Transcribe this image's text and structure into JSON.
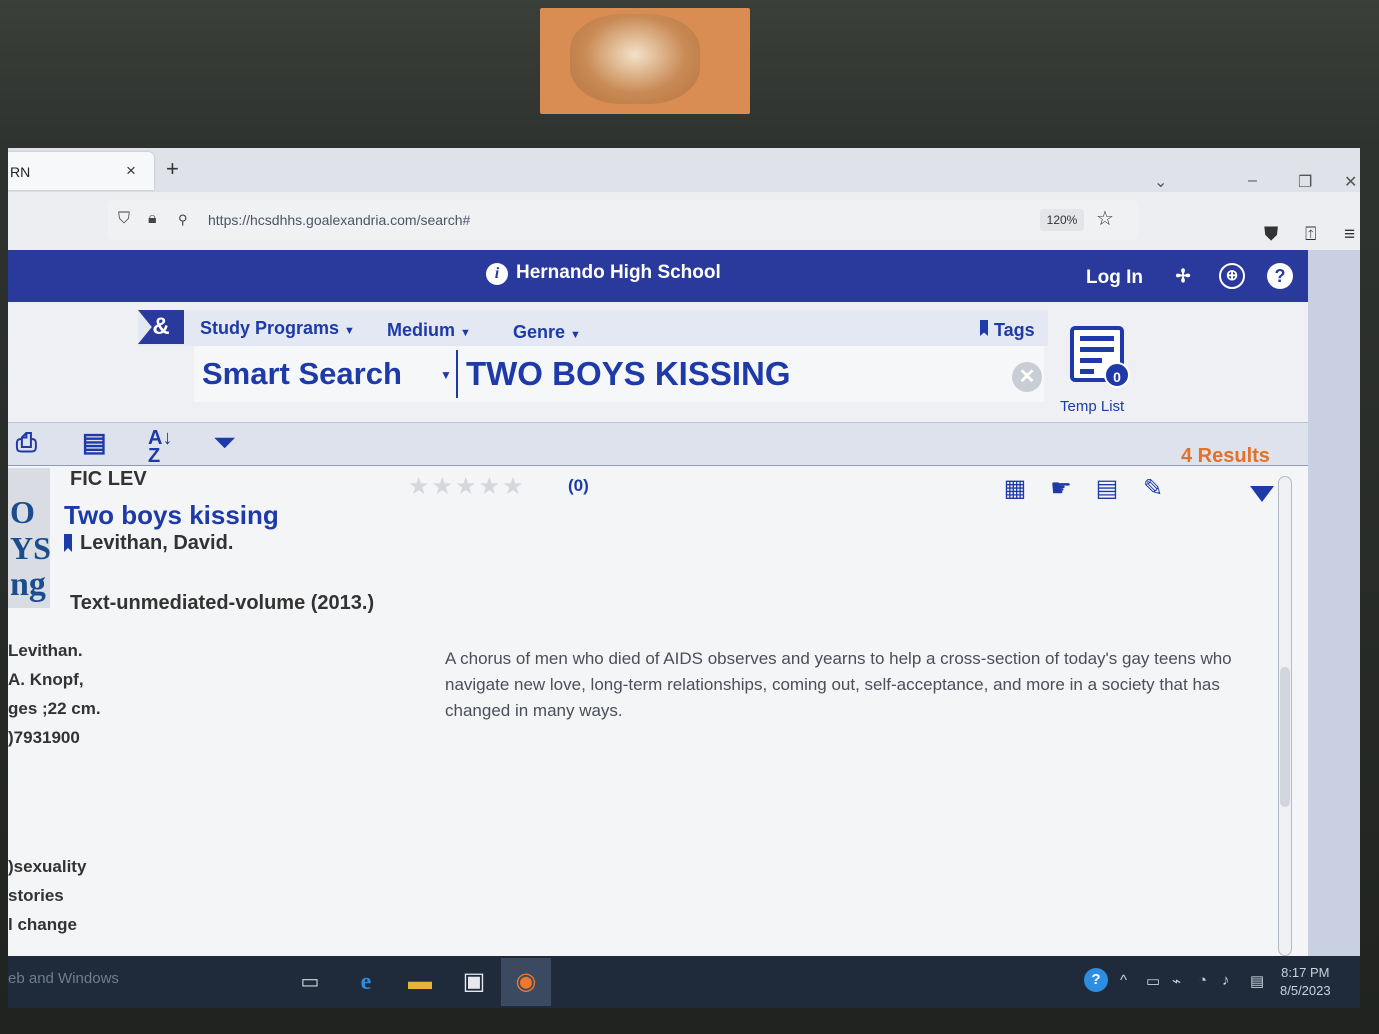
{
  "browser": {
    "tab_title": "RN",
    "tab_close": "×",
    "new_tab": "+",
    "url": "https://hcsdhhs.goalexandria.com/search#",
    "zoom": "120%"
  },
  "header": {
    "school_name": "Hernando High School",
    "login_label": "Log In"
  },
  "menu": {
    "amp_logo": "&",
    "items": [
      "Study Programs",
      "Medium",
      "Genre"
    ],
    "tags_label": "Tags"
  },
  "search": {
    "mode_label": "Smart Search",
    "query": "TWO BOYS KISSING"
  },
  "temp_list": {
    "label": "Temp List",
    "count": "0"
  },
  "results": {
    "count_label": "4 Results"
  },
  "result": {
    "call_number": "FIC LEV",
    "rating_count": "(0)",
    "title": "Two boys kissing",
    "author": "Levithan, David.",
    "format": "Text-unmediated-volume (2013.)",
    "details": [
      "Levithan.",
      "A. Knopf,",
      "ges ;22 cm.",
      ")7931900"
    ],
    "subjects": [
      ")sexuality",
      "stories",
      "l change"
    ],
    "summary": "A chorus of men who died of AIDS observes and yearns to help a cross-section of today's gay teens who navigate new love, long-term relationships, coming out, self-acceptance, and more in a society that has changed in many ways.",
    "cover_text": [
      "O",
      "YS",
      "ng"
    ]
  },
  "taskbar": {
    "search_text": "eb and Windows",
    "time": "8:17 PM",
    "date": "8/5/2023"
  },
  "colors": {
    "brand_blue": "#2a3a9c",
    "link_blue": "#1d3aa8",
    "results_orange": "#e2722a"
  }
}
